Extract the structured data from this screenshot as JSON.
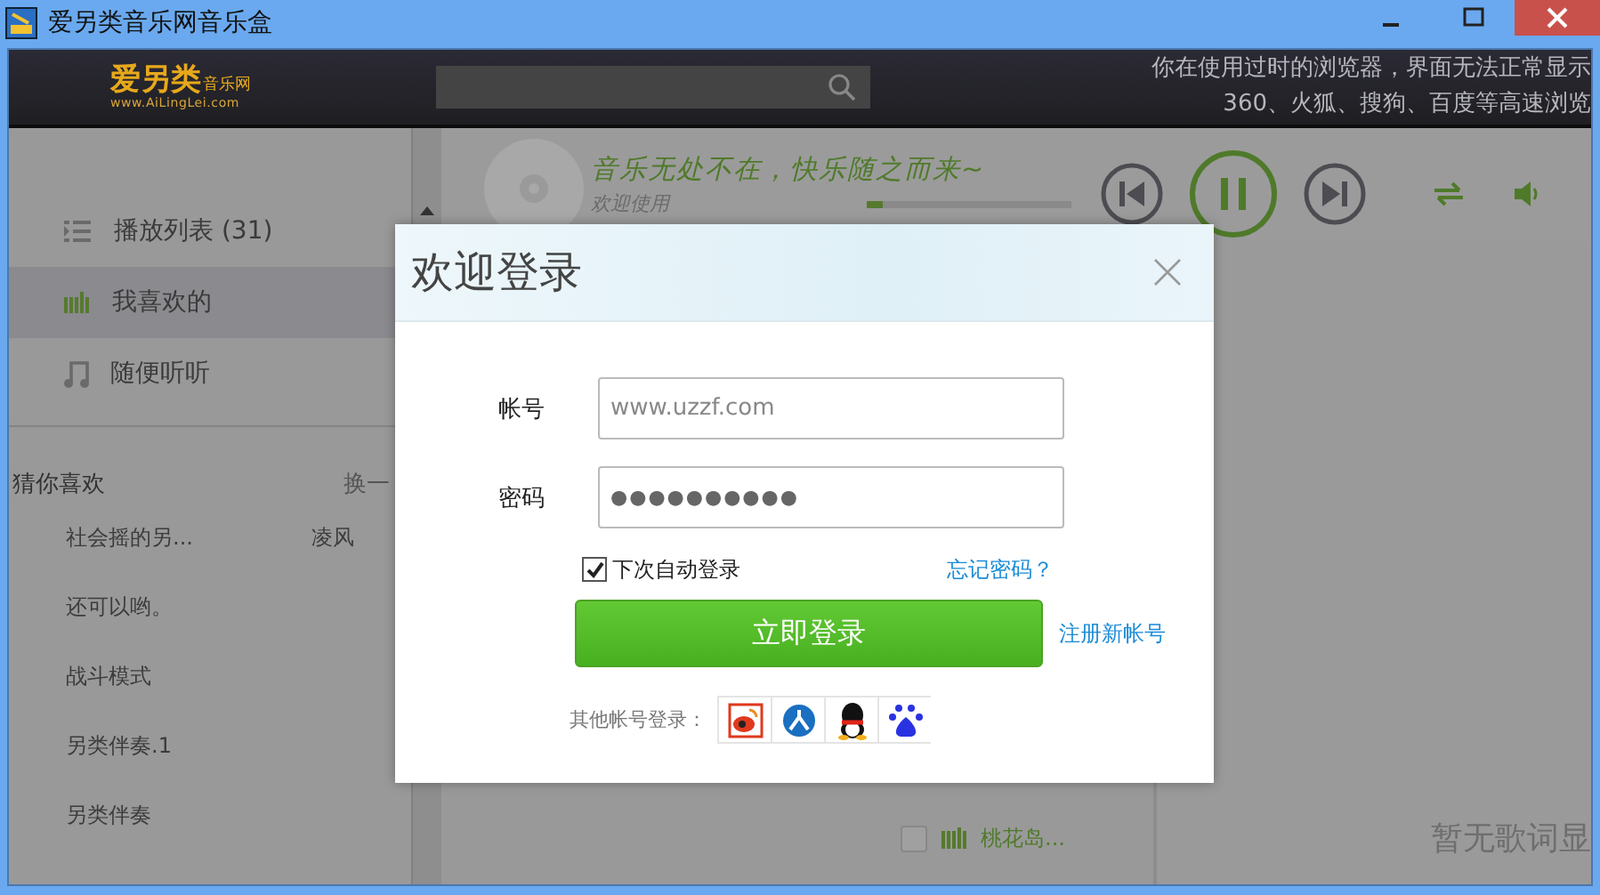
{
  "window": {
    "title": "爱另类音乐网音乐盒"
  },
  "header": {
    "logo": {
      "name": "爱另类",
      "suffix": "音乐网",
      "url": "www.AiLingLei.com"
    },
    "notice": [
      "你在使用过时的浏览器，界面无法正常显示",
      "360、火狐、搜狗、百度等高速浏览"
    ]
  },
  "sidebar": {
    "items": [
      {
        "kind": "list",
        "label": "播放列表 (31)",
        "selected": false
      },
      {
        "kind": "bars",
        "label": "我喜欢的",
        "selected": true
      },
      {
        "kind": "note",
        "label": "随便听听",
        "selected": false
      }
    ],
    "guess": {
      "title": "猜你喜欢",
      "action": "换一",
      "songs": [
        {
          "title": "社会摇的另...",
          "artist": "凌风"
        },
        {
          "title": "还可以哟。"
        },
        {
          "title": "战斗模式"
        },
        {
          "title": "另类伴奏.1"
        },
        {
          "title": "另类伴奏"
        }
      ]
    }
  },
  "player": {
    "slogan": "音乐无处不在，快乐随之而来~",
    "welcome": "欢迎使用",
    "progress": {
      "level": 0.08
    },
    "playing": true
  },
  "playlist": {
    "rows": [
      {
        "title": "桃花岛...",
        "checked": false,
        "playing": true
      }
    ]
  },
  "lyrics": {
    "message": "暂无歌词显"
  },
  "login": {
    "title": "欢迎登录",
    "fields": [
      {
        "kind": "text",
        "label": "帐号",
        "placeholder": "www.uzzf.com"
      },
      {
        "kind": "password",
        "label": "密码",
        "value": "●●●●●●●●●●"
      }
    ],
    "remember": {
      "label": "下次自动登录",
      "checked": true
    },
    "forgot": "忘记密码？",
    "submit": "立即登录",
    "register": "注册新帐号",
    "other": {
      "label": "其他帐号登录：",
      "providers": [
        {
          "kind": "weibo"
        },
        {
          "kind": "renren"
        },
        {
          "kind": "qq"
        },
        {
          "kind": "baidu"
        }
      ]
    }
  }
}
